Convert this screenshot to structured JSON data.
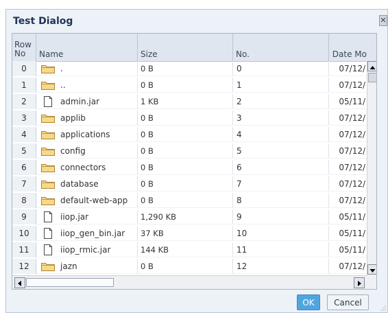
{
  "dialog": {
    "title": "Test Dialog",
    "close_icon": "close-icon"
  },
  "table": {
    "columns": [
      {
        "label": "Row No"
      },
      {
        "label": "Name"
      },
      {
        "label": "Size"
      },
      {
        "label": "No."
      },
      {
        "label": "Date Mo"
      }
    ],
    "row_no_label_lines": [
      "Row",
      "No"
    ],
    "rows": [
      {
        "no": "0",
        "icon": "folder-icon",
        "name": ".",
        "size": "0 B",
        "num": "0",
        "date": "07/12/"
      },
      {
        "no": "1",
        "icon": "folder-icon",
        "name": "..",
        "size": "0 B",
        "num": "1",
        "date": "07/12/"
      },
      {
        "no": "2",
        "icon": "file-icon",
        "name": "admin.jar",
        "size": "1 KB",
        "num": "2",
        "date": "05/11/"
      },
      {
        "no": "3",
        "icon": "folder-icon",
        "name": "applib",
        "size": "0 B",
        "num": "3",
        "date": "07/12/"
      },
      {
        "no": "4",
        "icon": "folder-icon",
        "name": "applications",
        "size": "0 B",
        "num": "4",
        "date": "07/12/"
      },
      {
        "no": "5",
        "icon": "folder-icon",
        "name": "config",
        "size": "0 B",
        "num": "5",
        "date": "07/12/"
      },
      {
        "no": "6",
        "icon": "folder-icon",
        "name": "connectors",
        "size": "0 B",
        "num": "6",
        "date": "07/12/"
      },
      {
        "no": "7",
        "icon": "folder-icon",
        "name": "database",
        "size": "0 B",
        "num": "7",
        "date": "07/12/"
      },
      {
        "no": "8",
        "icon": "folder-icon",
        "name": "default-web-app",
        "size": "0 B",
        "num": "8",
        "date": "07/12/"
      },
      {
        "no": "9",
        "icon": "file-icon",
        "name": "iiop.jar",
        "size": "1,290 KB",
        "num": "9",
        "date": "05/11/"
      },
      {
        "no": "10",
        "icon": "file-icon",
        "name": "iiop_gen_bin.jar",
        "size": "37 KB",
        "num": "10",
        "date": "05/11/"
      },
      {
        "no": "11",
        "icon": "file-icon",
        "name": "iiop_rmic.jar",
        "size": "144 KB",
        "num": "11",
        "date": "05/11/"
      },
      {
        "no": "12",
        "icon": "folder-icon",
        "name": "jazn",
        "size": "0 B",
        "num": "12",
        "date": "07/12/"
      }
    ]
  },
  "buttons": {
    "ok": "OK",
    "cancel": "Cancel"
  },
  "colors": {
    "accent": "#4fa6df",
    "title_text": "#1f3552",
    "folder_fill": "#f5d98c",
    "folder_stroke": "#b0832d"
  }
}
